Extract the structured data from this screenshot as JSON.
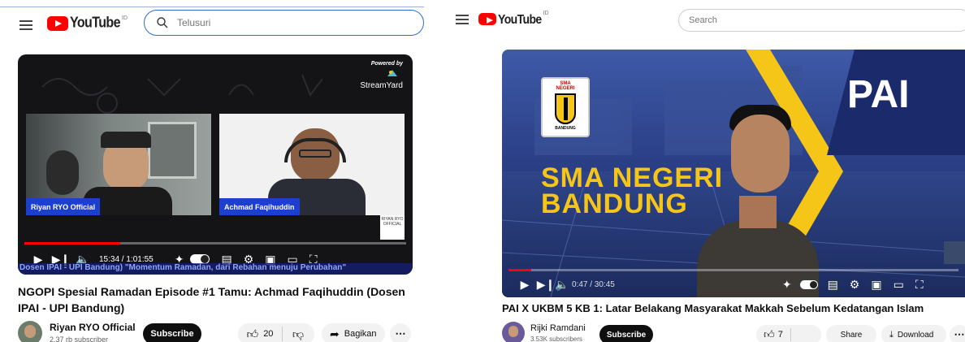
{
  "left": {
    "header": {
      "logo_text": "YouTube",
      "region": "ID",
      "search": {
        "placeholder": "Telusuri",
        "value": ""
      }
    },
    "video": {
      "powered_by": "Powered by",
      "streamyard": "StreamYard",
      "speaker_left": "Riyan RYO Official",
      "speaker_right": "Achmad Faqihuddin",
      "corner_badge": "RIYAN RYO OFFICIAL",
      "time": "15:34 / 1:01:55",
      "progress": 0.25,
      "ticker": "Dosen IPAI - UPI Bandung) \"Momentum Ramadan, dari Rebahan menuju Perubahan\""
    },
    "title_line1": "NGOPI Spesial Ramadan Episode #1 Tamu: Achmad Faqihuddin (Dosen",
    "title_line2": "IPAI - UPI Bandung)",
    "channel": {
      "name": "Riyan RYO Official",
      "subscribers": "2,37 rb subscriber"
    },
    "subscribe_label": "Subscribe",
    "like_count": "20",
    "share_label": "Bagikan",
    "more_label": "⋯"
  },
  "right": {
    "header": {
      "logo_text": "YouTube",
      "region": "ID",
      "search": {
        "placeholder": "Search",
        "value": ""
      }
    },
    "video": {
      "big_text": "PAI",
      "school_line1": "SMA NEGERI",
      "school_line2": "BANDUNG",
      "logo_line1": "SMA",
      "logo_line2": "NEGERI",
      "logo_line3": "BANDUNG",
      "time": "0:47 / 30:45",
      "progress": 0.05
    },
    "title": "PAI X UKBM 5 KB 1: Latar Belakang Masyarakat Makkah Sebelum Kedatangan Islam",
    "channel": {
      "name": "Rijki Ramdani",
      "subscribers": "3.53K subscribers"
    },
    "subscribe_label": "Subscribe",
    "like_count": "7",
    "share_label": "Share",
    "download_label": "Download",
    "more_label": "⋯"
  },
  "colors": {
    "youtube_red": "#ff0000",
    "name_tag_blue": "#1c3fcf",
    "pai_navy": "#1b2a6b",
    "school_yellow": "#f5c518"
  }
}
